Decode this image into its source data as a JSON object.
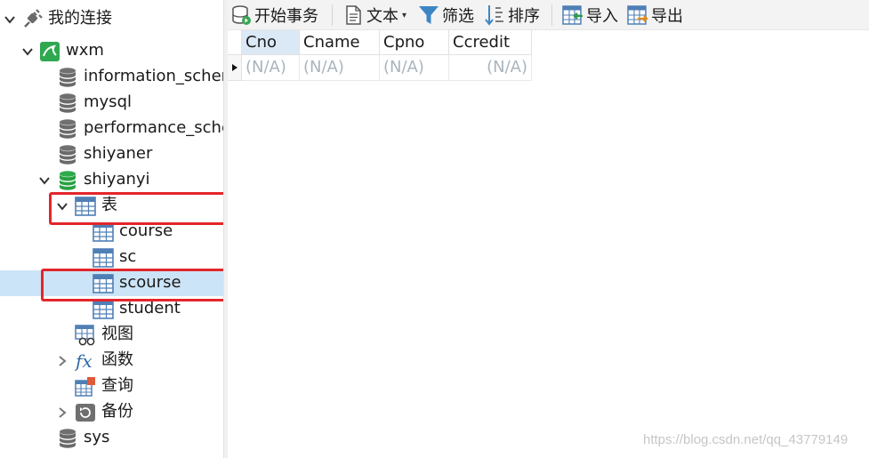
{
  "tree": {
    "root": {
      "label": "我的连接",
      "expanded": true
    },
    "connection": {
      "label": "wxm",
      "expanded": true
    },
    "databases": [
      {
        "label": "information_schema",
        "icon": "database-icon-gray"
      },
      {
        "label": "mysql",
        "icon": "database-icon-gray"
      },
      {
        "label": "performance_schema",
        "icon": "database-icon-gray"
      },
      {
        "label": "shiyaner",
        "icon": "database-icon-gray"
      },
      {
        "label": "shiyanyi",
        "icon": "database-icon-green",
        "expanded": true
      },
      {
        "label": "sys",
        "icon": "database-icon-gray"
      }
    ],
    "shiyanyi_children": {
      "tables_folder": {
        "label": "表",
        "expanded": true
      },
      "tables": [
        {
          "label": "course",
          "selected": false
        },
        {
          "label": "sc",
          "selected": false
        },
        {
          "label": "scourse",
          "selected": true
        },
        {
          "label": "student",
          "selected": false
        }
      ],
      "views": {
        "label": "视图"
      },
      "functions": {
        "label": "函数",
        "collapsed": true
      },
      "queries": {
        "label": "查询"
      },
      "backups": {
        "label": "备份",
        "collapsed": true
      }
    }
  },
  "toolbar": {
    "begin_transaction": "开始事务",
    "text": "文本",
    "filter": "筛选",
    "sort": "排序",
    "import": "导入",
    "export": "导出"
  },
  "grid": {
    "columns": [
      "Cno",
      "Cname",
      "Cpno",
      "Ccredit"
    ],
    "rows": [
      [
        "(N/A)",
        "(N/A)",
        "(N/A)",
        "(N/A)"
      ]
    ]
  },
  "watermark": "https://blog.csdn.net/qq_43779149",
  "colors": {
    "selection": "#cce4f7",
    "highlight_box": "#e3262b",
    "null_text": "#a9b4be",
    "active_header": "#dbe8f6"
  }
}
